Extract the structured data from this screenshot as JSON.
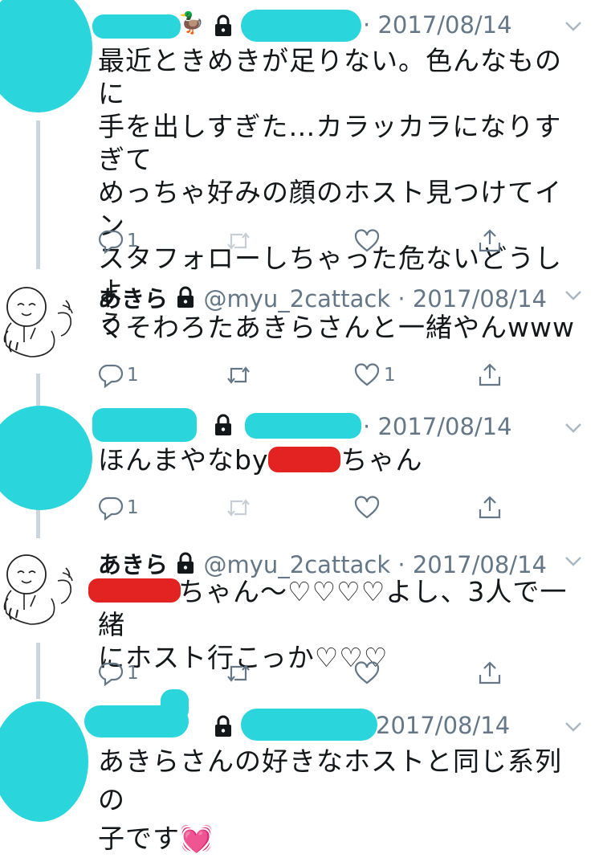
{
  "tweets": [
    {
      "date": "2017/08/14",
      "text_lines": [
        "最近ときめきが足りない。色んなものに",
        "手を出しすぎた…カラッカラになりすぎて",
        "めっちゃ好みの顔のホスト見つけてイン",
        "スタフォローしちゃった危ないどうしよ",
        "う"
      ],
      "reply_count": "1",
      "like_count": ""
    },
    {
      "name": "あきら",
      "handle": "@myu_2cattack",
      "date": "2017/08/14",
      "text_lines": [
        "くそわろたあきらさんと一緒やんwww"
      ],
      "reply_count": "1",
      "like_count": "1"
    },
    {
      "date": "2017/08/14",
      "text_before": "ほんまやなby",
      "text_after": "ちゃん",
      "reply_count": "1",
      "like_count": ""
    },
    {
      "name": "あきら",
      "handle": "@myu_2cattack",
      "date": "2017/08/14",
      "text_line1": "ちゃん〜♡♡♡♡よし、3人で一緒",
      "text_line2": "にホスト行こっか♡♡♡",
      "reply_count": "1",
      "like_count": ""
    },
    {
      "date": "2017/08/14",
      "text_lines": [
        "あきらさんの好きなホストと同じ系列の",
        "子です💓"
      ]
    }
  ],
  "colors": {
    "redact_cyan": "#2ad6dc",
    "redact_red": "#e32322",
    "meta_gray": "#657786",
    "thread_line": "#ccd6dd"
  },
  "icons": [
    "reply-icon",
    "retweet-icon",
    "like-icon",
    "share-icon",
    "lock-icon",
    "chevron-down-icon"
  ]
}
